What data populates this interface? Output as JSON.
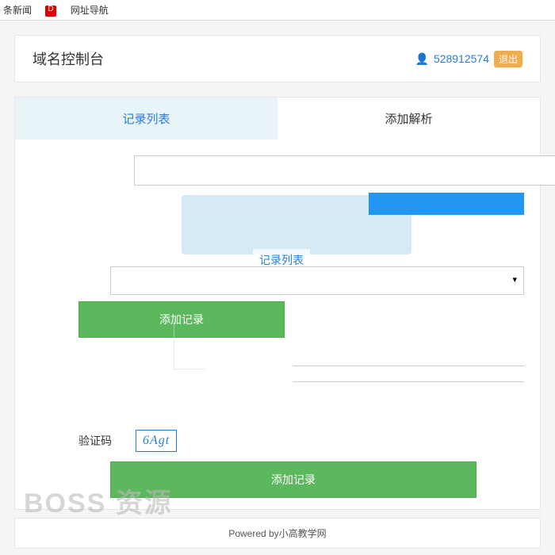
{
  "topbar": {
    "news_label": "条新闻",
    "nav_label": "网址导航"
  },
  "header": {
    "title": "域名控制台",
    "user_id": "528912574",
    "logout_label": "退出"
  },
  "tabs": {
    "record_list": "记录列表",
    "add_resolve": "添加解析"
  },
  "ghost": {
    "record_list_label": "记录列表"
  },
  "buttons": {
    "add_record": "添加记录"
  },
  "captcha": {
    "label": "验证码",
    "code": "6Agt"
  },
  "watermark": "BOSS 资源",
  "footer": {
    "text": "Powered by小高教学网"
  }
}
